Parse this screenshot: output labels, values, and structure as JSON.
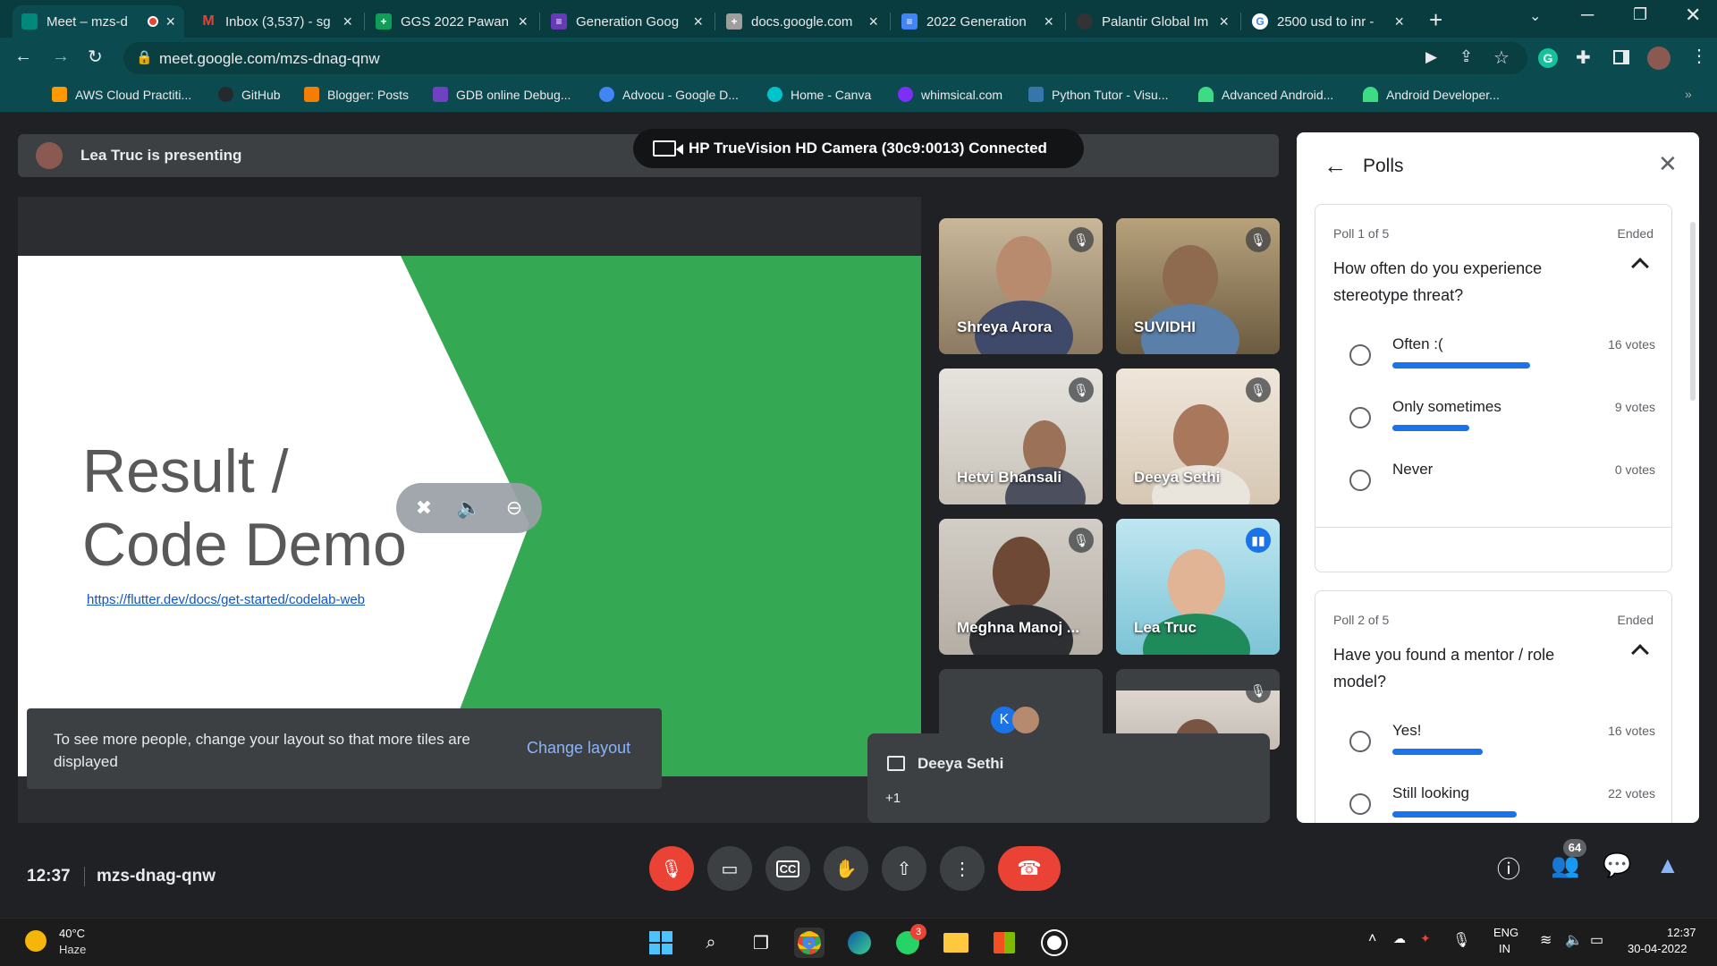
{
  "browser": {
    "tabs": [
      {
        "title": "Meet – mzs-d",
        "favicon_color": "#00897b",
        "favicon": "",
        "recording": true
      },
      {
        "title": "Inbox (3,537) - sg",
        "favicon_color": "#ea4335",
        "favicon": "M"
      },
      {
        "title": "GGS 2022 Pawan",
        "favicon_color": "#0f9d58",
        "favicon": "+"
      },
      {
        "title": "Generation Goog",
        "favicon_color": "#673ab7",
        "favicon": "≡"
      },
      {
        "title": "docs.google.com",
        "favicon_color": "#9e9e9e",
        "favicon": "+"
      },
      {
        "title": "2022 Generation",
        "favicon_color": "#4285f4",
        "favicon": "≡"
      },
      {
        "title": "Palantir Global Im",
        "favicon_color": "#333333",
        "favicon": ""
      },
      {
        "title": "2500 usd to inr -",
        "favicon_color": "#ffffff",
        "favicon": "G"
      }
    ],
    "url": "meet.google.com/mzs-dnag-qnw",
    "bookmarks": [
      {
        "label": "AWS Cloud Practiti...",
        "color": "#ff9900"
      },
      {
        "label": "GitHub",
        "color": "#24292e"
      },
      {
        "label": "Blogger: Posts",
        "color": "#f57d00"
      },
      {
        "label": "GDB online Debug...",
        "color": "#6f42c1"
      },
      {
        "label": "Advocu - Google D...",
        "color": "#4285f4"
      },
      {
        "label": "Home - Canva",
        "color": "#00c4cc"
      },
      {
        "label": "whimsical.com",
        "color": "#7b2ff7"
      },
      {
        "label": "Python Tutor - Visu...",
        "color": "#3776ab"
      },
      {
        "label": "Advanced Android...",
        "color": "#3ddc84"
      },
      {
        "label": "Android Developer...",
        "color": "#3ddc84"
      }
    ]
  },
  "meet": {
    "presenting": "Lea Truc is presenting",
    "camera_toast": "HP TrueVision HD Camera (30c9:0013)  Connected",
    "slide": {
      "title_line1": "Result /",
      "title_line2": "Code Demo",
      "link": "https://flutter.dev/docs/get-started/codelab-web"
    },
    "layout_toast": {
      "message": "To see more people, change your layout so that more tiles are displayed",
      "action": "Change layout"
    },
    "participants": [
      {
        "name": "Shreya Arora",
        "muted": true,
        "bg": "#b7a58a"
      },
      {
        "name": "SUVIDHI",
        "muted": true,
        "bg": "#9a8a6a"
      },
      {
        "name": "Hetvi Bhansali",
        "muted": true,
        "bg": "#d9d6d0"
      },
      {
        "name": "Deeya Sethi",
        "muted": true,
        "bg": "#e8dccf"
      },
      {
        "name": "Meghna Manoj ...",
        "muted": true,
        "bg": "#c9c4be"
      },
      {
        "name": "Lea Truc",
        "muted": false,
        "speaking": true,
        "bg": "#9fd3e2"
      }
    ],
    "more_tile_initial": "K",
    "chat_toast": {
      "name": "Deeya Sethi",
      "more": "+1"
    },
    "clock": "12:37",
    "meeting_code": "mzs-dnag-qnw",
    "people_count": "64"
  },
  "polls": {
    "title": "Polls",
    "items": [
      {
        "number": "Poll 1 of 5",
        "status": "Ended",
        "question": "How often do you experience stereotype threat?",
        "options": [
          {
            "label": "Often :(",
            "votes": "16 votes",
            "fraction": 0.64
          },
          {
            "label": "Only sometimes",
            "votes": "9 votes",
            "fraction": 0.36
          },
          {
            "label": "Never",
            "votes": "0 votes",
            "fraction": 0
          }
        ]
      },
      {
        "number": "Poll 2 of 5",
        "status": "Ended",
        "question": "Have you found a mentor / role model?",
        "options": [
          {
            "label": "Yes!",
            "votes": "16 votes",
            "fraction": 0.42
          },
          {
            "label": "Still looking",
            "votes": "22 votes",
            "fraction": 0.58
          }
        ]
      }
    ]
  },
  "taskbar": {
    "weather_temp": "40°C",
    "weather_desc": "Haze",
    "lang_line1": "ENG",
    "lang_line2": "IN",
    "time": "12:37",
    "date": "30-04-2022",
    "whatsapp_badge": "3"
  },
  "colors": {
    "meet_green": "#34a853",
    "accent_blue": "#1a73e8",
    "end_red": "#ea4335"
  }
}
